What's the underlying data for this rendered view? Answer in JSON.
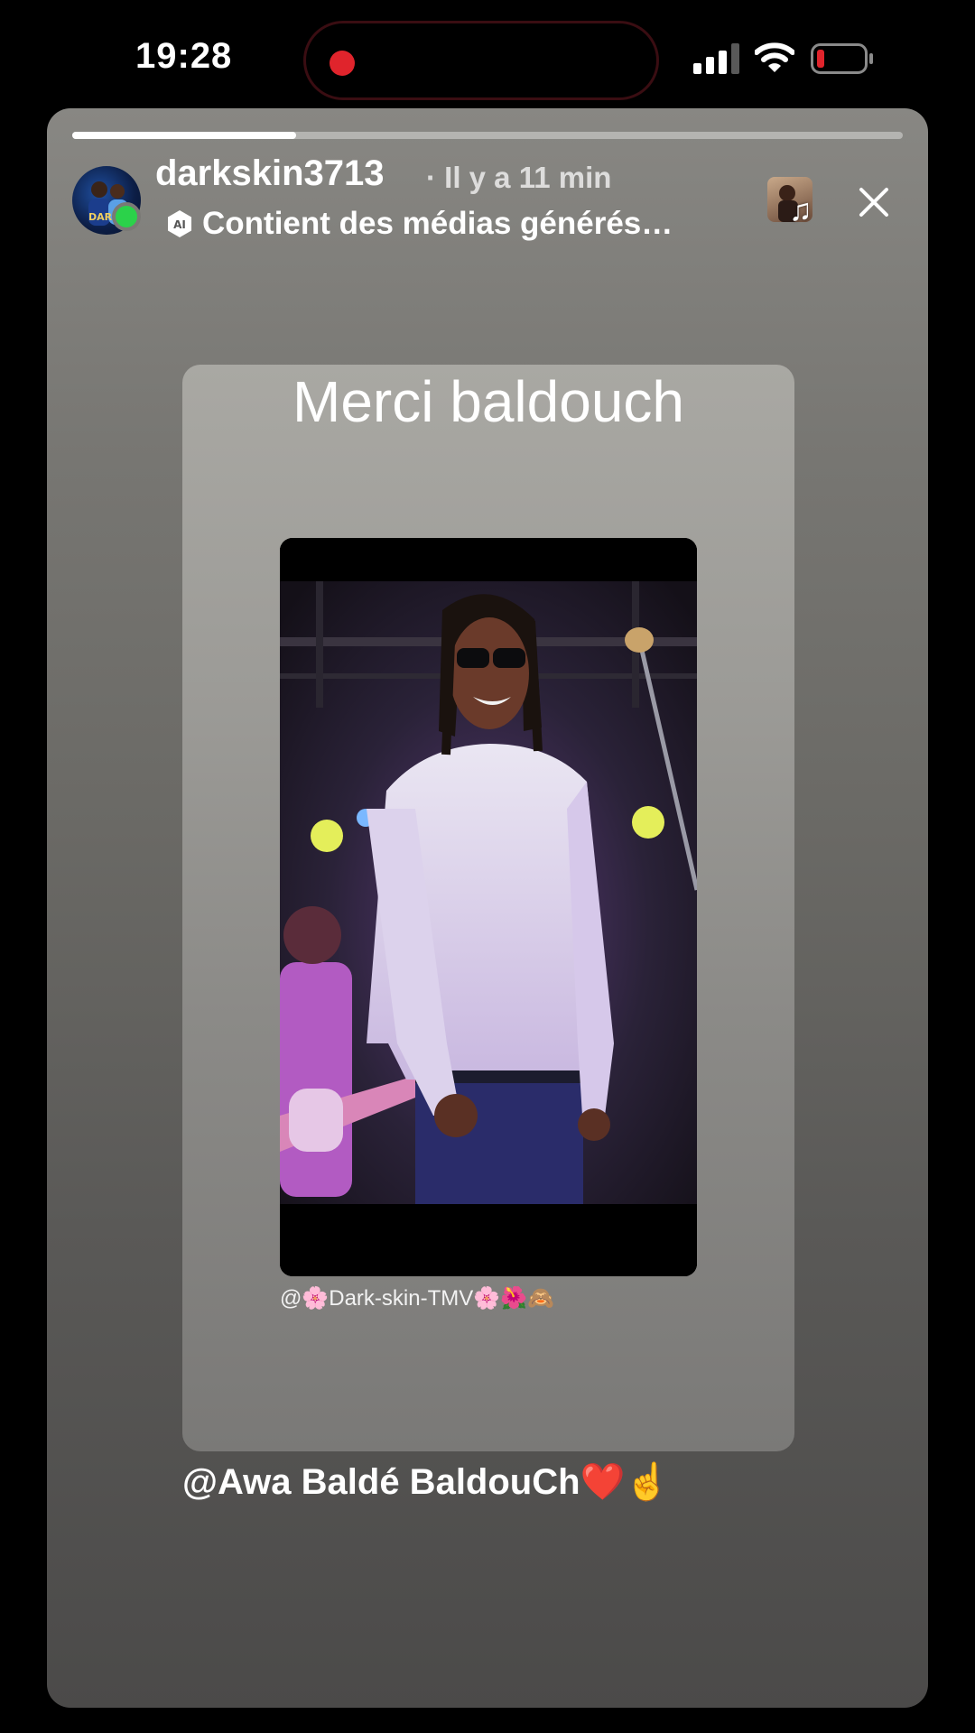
{
  "status_bar": {
    "time": "19:28",
    "icons": [
      "recording-indicator",
      "cellular-signal-icon",
      "wifi-icon",
      "battery-low-icon"
    ],
    "recording_color": "#e0242c",
    "battery_color": "#e0242c"
  },
  "story": {
    "progress": 0.27,
    "username": "darkskin3713",
    "time_ago": "· Il y a 11 min",
    "ai_badge_icon": "ai-badge-icon",
    "ai_label": "Contient des médias générés…",
    "music_icon": "♫",
    "close_icon": "close-icon",
    "online_color": "#2bd24a",
    "title": "Merci baldouch",
    "media_watermark": "@🌸Dark-skin-TMV🌸🌺🙈",
    "mention": "@Awa Baldé BaldouCh❤️☝️"
  }
}
